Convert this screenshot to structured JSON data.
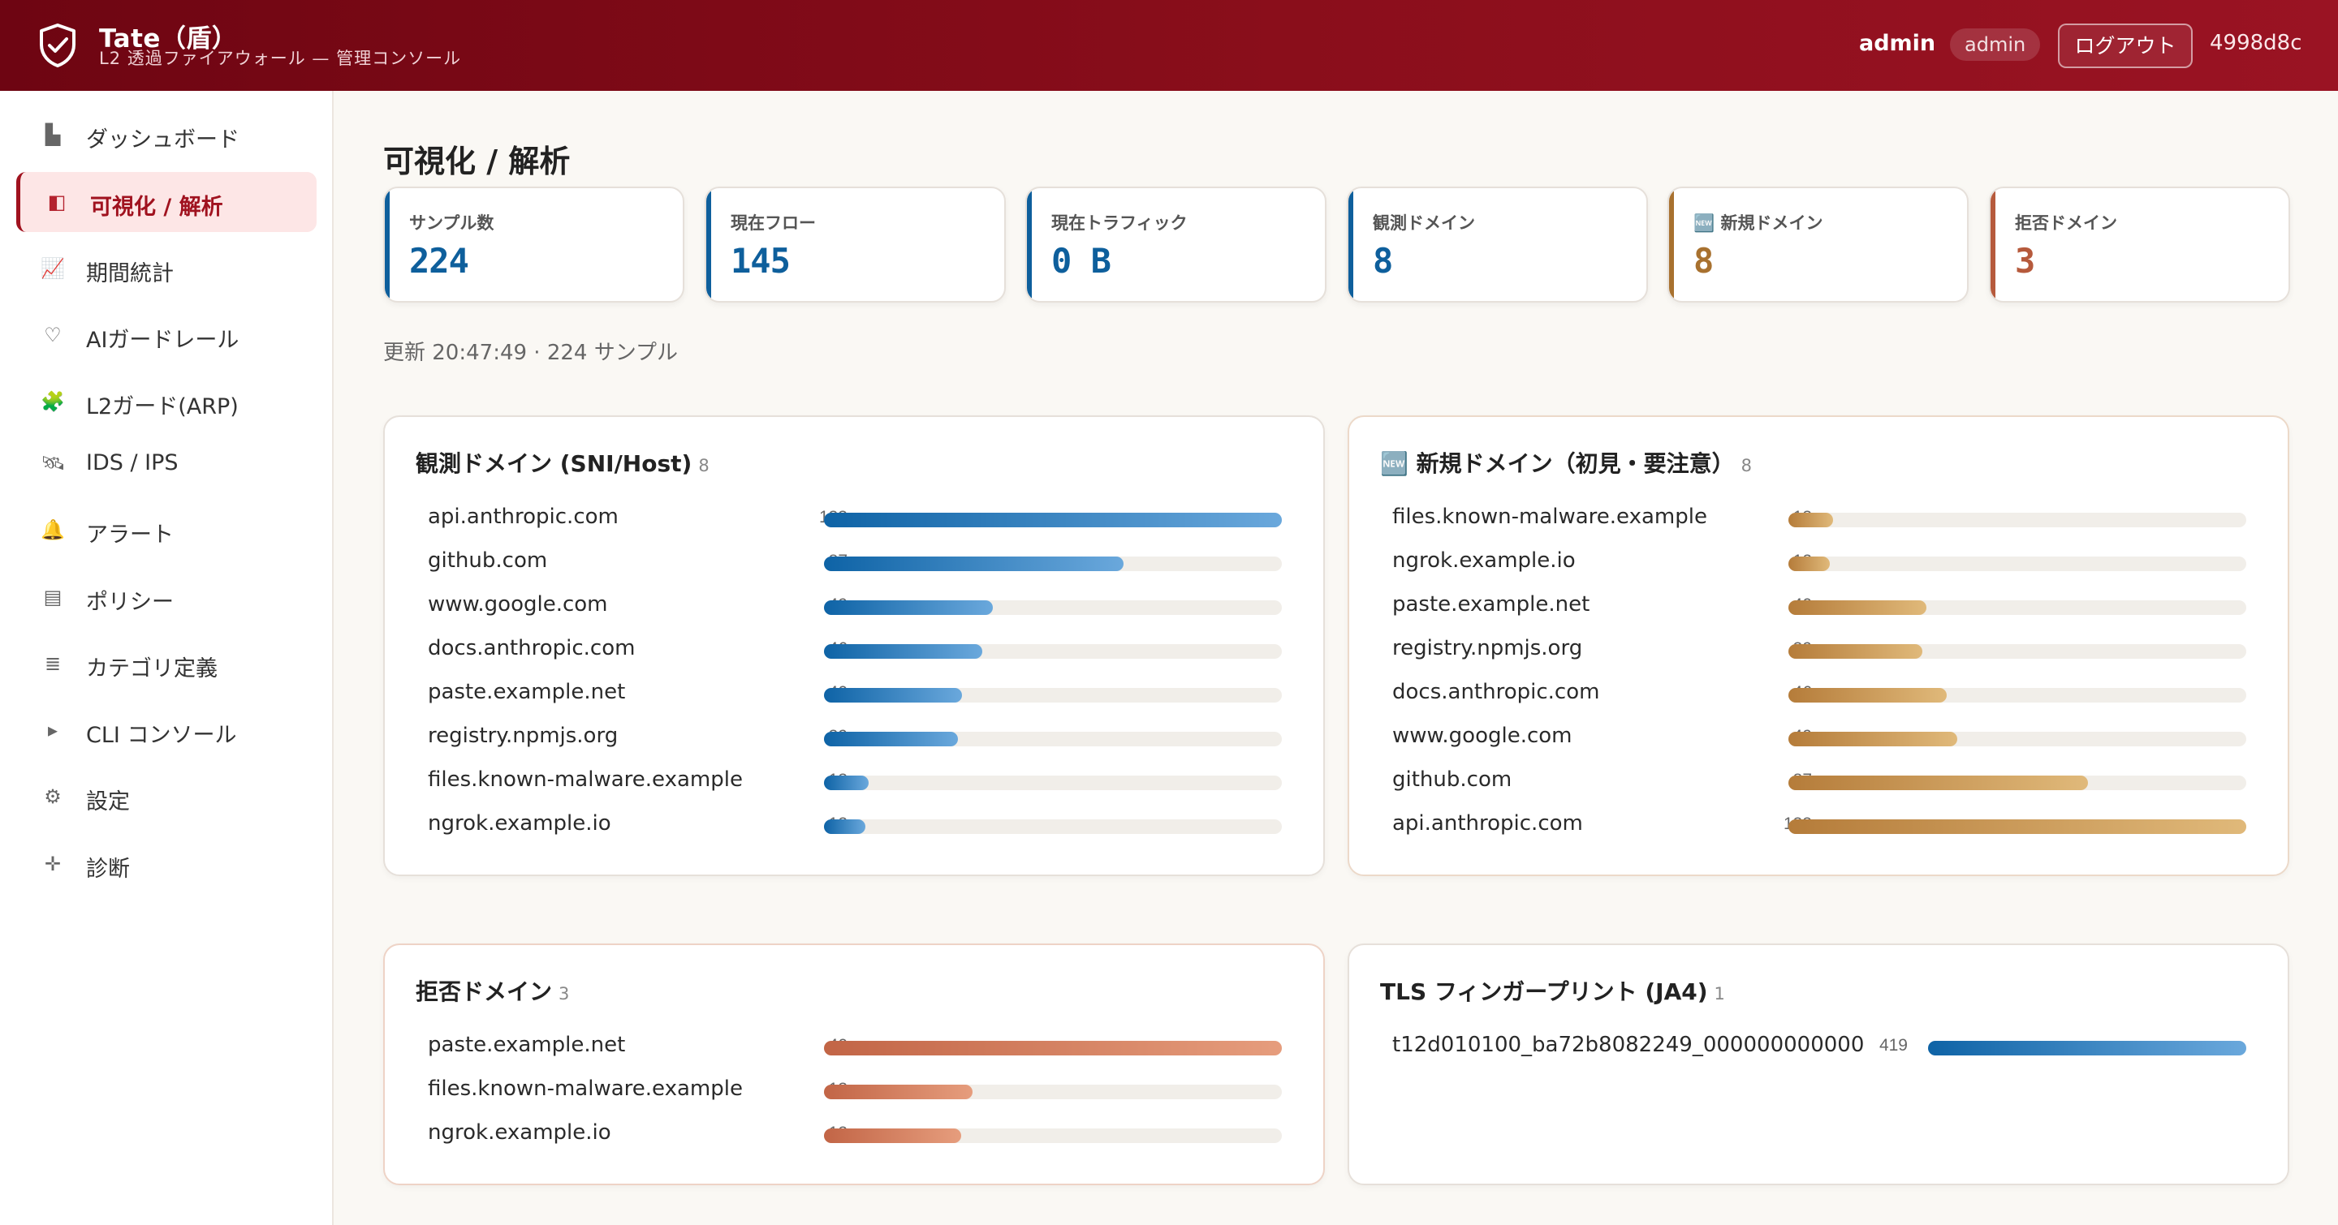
{
  "header": {
    "title": "Tate（盾）",
    "subtitle": "L2 透過ファイアウォール — 管理コンソール",
    "user": "admin",
    "role": "admin",
    "logout_label": "ログアウト",
    "build": "4998d8c",
    "logo_icon": "shield-check-icon"
  },
  "sidebar": {
    "items": [
      {
        "label": "ダッシュボード",
        "icon": "dashboard-icon",
        "glyph": "▙"
      },
      {
        "label": "可視化 / 解析",
        "icon": "visualize-icon",
        "glyph": "◧",
        "active": true
      },
      {
        "label": "期間統計",
        "icon": "chart-up-icon",
        "glyph": "📈"
      },
      {
        "label": "AIガードレール",
        "icon": "heart-shield-icon",
        "glyph": "♡"
      },
      {
        "label": "L2ガード(ARP)",
        "icon": "puzzle-icon",
        "glyph": "🧩"
      },
      {
        "label": "IDS / IPS",
        "icon": "satellite-icon",
        "glyph": "🛰"
      },
      {
        "label": "アラート",
        "icon": "bell-icon",
        "glyph": "🔔"
      },
      {
        "label": "ポリシー",
        "icon": "list-icon",
        "glyph": "▤"
      },
      {
        "label": "カテゴリ定義",
        "icon": "lines-icon",
        "glyph": "≣"
      },
      {
        "label": "CLI コンソール",
        "icon": "play-icon",
        "glyph": "▸"
      },
      {
        "label": "設定",
        "icon": "gear-icon",
        "glyph": "⚙"
      },
      {
        "label": "診断",
        "icon": "crosshair-icon",
        "glyph": "✛"
      }
    ]
  },
  "main": {
    "title": "可視化 / 解析",
    "updated": "更新 20:47:49 · 224 サンプル",
    "stats": [
      {
        "label": "サンプル数",
        "value": "224",
        "color": "#0e5f9c"
      },
      {
        "label": "現在フロー",
        "value": "145",
        "color": "#0e5f9c"
      },
      {
        "label": "現在トラフィック",
        "value": "0 B",
        "color": "#0e5f9c"
      },
      {
        "label": "観測ドメイン",
        "value": "8",
        "color": "#0e5f9c"
      },
      {
        "label": "🆕 新規ドメイン",
        "value": "8",
        "color": "#a8712f"
      },
      {
        "label": "拒否ドメイン",
        "value": "3",
        "color": "#b65a3c"
      }
    ]
  },
  "panels": {
    "observed": {
      "title": "観測ドメイン (SNI/Host)",
      "count": "8",
      "rows": [
        {
          "name": "api.anthropic.com",
          "value": 133
        },
        {
          "name": "github.com",
          "value": 87
        },
        {
          "name": "www.google.com",
          "value": 49
        },
        {
          "name": "docs.anthropic.com",
          "value": 46
        },
        {
          "name": "paste.example.net",
          "value": 40
        },
        {
          "name": "registry.npmjs.org",
          "value": 39
        },
        {
          "name": "files.known-malware.example",
          "value": 13
        },
        {
          "name": "ngrok.example.io",
          "value": 12
        }
      ]
    },
    "new": {
      "title": "🆕 新規ドメイン（初見・要注意）",
      "count": "8",
      "rows": [
        {
          "name": "files.known-malware.example",
          "value": 13
        },
        {
          "name": "ngrok.example.io",
          "value": 12
        },
        {
          "name": "paste.example.net",
          "value": 40
        },
        {
          "name": "registry.npmjs.org",
          "value": 39
        },
        {
          "name": "docs.anthropic.com",
          "value": 46
        },
        {
          "name": "www.google.com",
          "value": 49
        },
        {
          "name": "github.com",
          "value": 87
        },
        {
          "name": "api.anthropic.com",
          "value": 133
        }
      ]
    },
    "denied": {
      "title": "拒否ドメイン",
      "count": "3",
      "rows": [
        {
          "name": "paste.example.net",
          "value": 40
        },
        {
          "name": "files.known-malware.example",
          "value": 13
        },
        {
          "name": "ngrok.example.io",
          "value": 12
        }
      ]
    },
    "tls": {
      "title": "TLS フィンガープリント (JA4)",
      "count": "1",
      "rows": [
        {
          "name": "t12d010100_ba72b8082249_000000000000",
          "value": 419
        }
      ]
    }
  }
}
